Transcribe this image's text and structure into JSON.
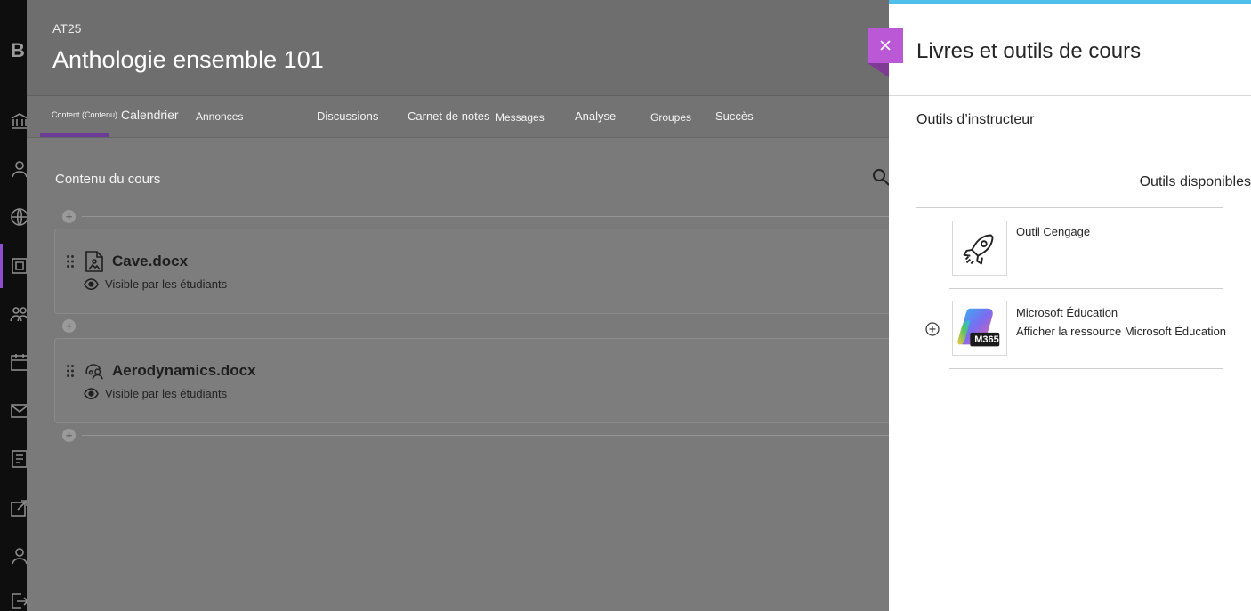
{
  "course": {
    "code": "AT25",
    "title": "Anthologie ensemble 101"
  },
  "tabs": [
    {
      "label": "Content (Contenu)",
      "active": true
    },
    {
      "label": "Calendrier"
    },
    {
      "label": "Annonces"
    },
    {
      "label": "Discussions"
    },
    {
      "label": "Carnet de notes"
    },
    {
      "label": "Messages"
    },
    {
      "label": "Analyse"
    },
    {
      "label": "Groupes"
    },
    {
      "label": "Succès"
    }
  ],
  "content": {
    "section_title": "Contenu du cours",
    "items": [
      {
        "name": "Cave.docx",
        "visibility": "Visible par les étudiants",
        "icon": "document-image-icon"
      },
      {
        "name": "Aerodynamics.docx",
        "visibility": "Visible par les étudiants",
        "icon": "document-people-icon"
      }
    ]
  },
  "panel": {
    "title": "Livres et outils de cours",
    "subtitle": "Outils d’instructeur",
    "available_label": "Outils disponibles",
    "tools": [
      {
        "name": "Outil Cengage",
        "description": "",
        "icon": "rocket-icon"
      },
      {
        "name": "Microsoft Éducation",
        "description": "Afficher la ressource Microsoft Éducation",
        "icon": "m365-logo",
        "logo_text": "M365"
      }
    ]
  },
  "colors": {
    "accent_purple": "#ba58d6",
    "top_bar_blue": "#4ebfe9",
    "tab_underline": "#6b3d98"
  }
}
